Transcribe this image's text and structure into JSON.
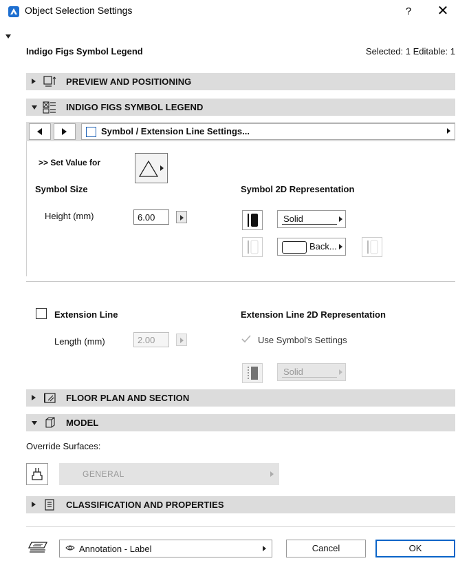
{
  "window": {
    "title": "Object Selection Settings",
    "help_label": "?",
    "close_label": "✕"
  },
  "header": {
    "object_name": "Indigo Figs Symbol Legend",
    "selection_info": "Selected: 1 Editable: 1"
  },
  "sections": {
    "preview": "PREVIEW AND POSITIONING",
    "legend": "INDIGO FIGS SYMBOL LEGEND",
    "floor_plan": "FLOOR PLAN AND SECTION",
    "model": "MODEL",
    "classification": "CLASSIFICATION AND PROPERTIES"
  },
  "page_nav": {
    "current_page": "Symbol / Extension Line Settings..."
  },
  "symbol": {
    "set_value_label": ">> Set Value for",
    "size_heading": "Symbol Size",
    "height_label": "Height (mm)",
    "height_value": "6.00",
    "rep_heading": "Symbol 2D Representation",
    "fill_type": "Solid",
    "background_label": "Back..."
  },
  "extension": {
    "checkbox_label": "Extension Line",
    "checked": false,
    "length_label": "Length (mm)",
    "length_value": "2.00",
    "rep_heading": "Extension Line 2D Representation",
    "use_symbol_label": "Use Symbol's Settings",
    "use_symbol_checked": true,
    "line_type": "Solid"
  },
  "model": {
    "override_label": "Override Surfaces:",
    "surface_value": "GENERAL"
  },
  "footer": {
    "layer_value": "Annotation - Label",
    "cancel_label": "Cancel",
    "ok_label": "OK"
  },
  "colors": {
    "accent": "#0a64c8",
    "section_bar": "#dcdcdc"
  }
}
